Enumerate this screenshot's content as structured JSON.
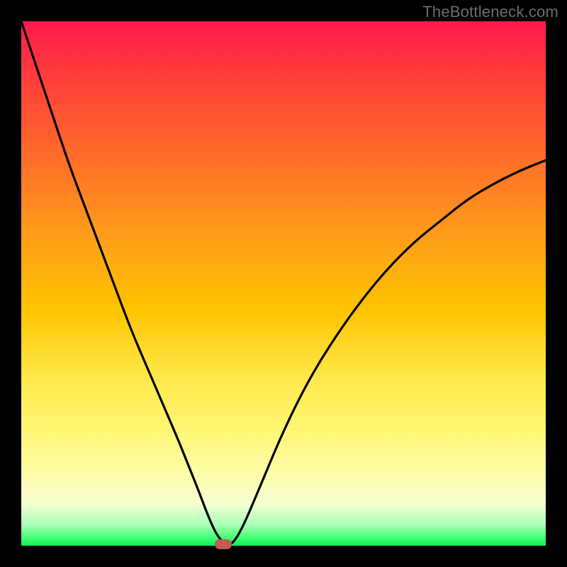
{
  "watermark": "TheBottleneck.com",
  "colors": {
    "frame": "#000000",
    "curve": "#000000",
    "marker": "#c25b56"
  },
  "chart_data": {
    "type": "line",
    "title": "",
    "xlabel": "",
    "ylabel": "",
    "xlim": [
      0,
      100
    ],
    "ylim": [
      0,
      100
    ],
    "grid": false,
    "legend": false,
    "series": [
      {
        "name": "bottleneck-curve",
        "x": [
          0,
          3,
          6,
          9,
          12,
          15,
          18,
          21,
          24,
          27,
          30,
          32,
          34,
          35.5,
          37,
          38.5,
          40,
          42,
          45,
          50,
          55,
          60,
          65,
          70,
          75,
          80,
          85,
          90,
          95,
          100
        ],
        "y": [
          100,
          91,
          82,
          73,
          65,
          57,
          49,
          41,
          34,
          27,
          20,
          15,
          10,
          6,
          2.5,
          0.5,
          0,
          3,
          10,
          22,
          32,
          40,
          47,
          53,
          58,
          62,
          66,
          69,
          71.5,
          73.5
        ]
      }
    ],
    "marker": {
      "x": 38.5,
      "y": 0
    },
    "background_gradient": {
      "axis": "y",
      "stops": [
        {
          "y": 100,
          "color": "#ff1a4d"
        },
        {
          "y": 55,
          "color": "#ffc400"
        },
        {
          "y": 10,
          "color": "#fffca8"
        },
        {
          "y": 0,
          "color": "#17e85a"
        }
      ]
    }
  }
}
